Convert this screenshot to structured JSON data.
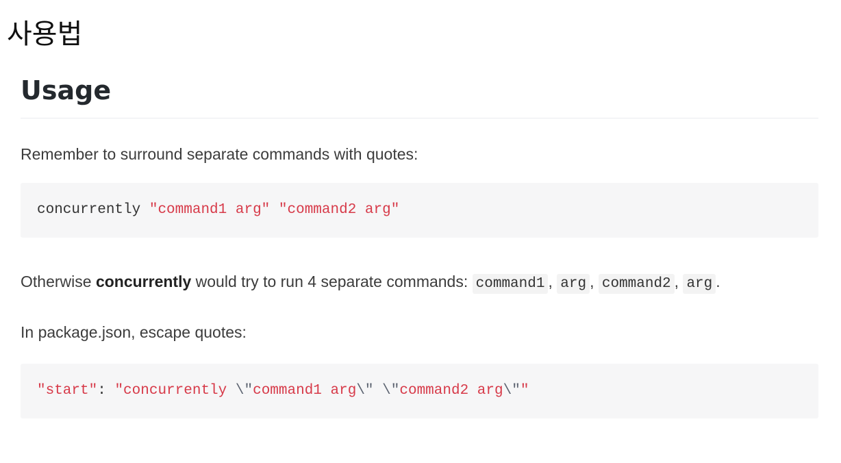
{
  "page": {
    "title": "사용법"
  },
  "usage": {
    "heading": "Usage",
    "intro": "Remember to surround separate commands with quotes:",
    "code1": {
      "cmd": "concurrently",
      "arg1": "\"command1 arg\"",
      "arg2": "\"command2 arg\""
    },
    "otherwise": {
      "before": "Otherwise ",
      "strong": "concurrently",
      "after": " would try to run 4 separate commands: ",
      "codes": [
        "command1",
        "arg",
        "command2",
        "arg"
      ],
      "sep": ", ",
      "end": "."
    },
    "package_intro": "In package.json, escape quotes:",
    "code2": {
      "key": "\"start\"",
      "colon": ": ",
      "value_start": "\"concurrently ",
      "esc1": "\\\"",
      "mid1": "command1 arg",
      "esc2": "\\\"",
      "space": " ",
      "esc3": "\\\"",
      "mid2": "command2 arg",
      "esc4": "\\\"",
      "value_end": "\""
    }
  }
}
